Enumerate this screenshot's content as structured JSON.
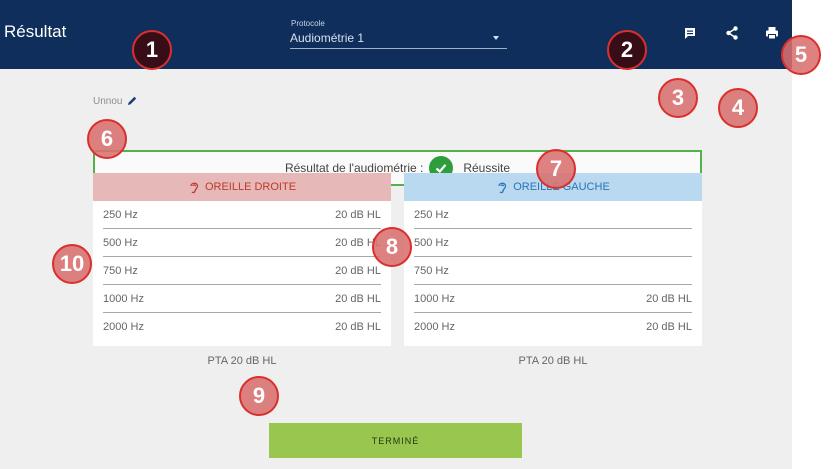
{
  "header": {
    "title": "Résultat",
    "protocol_label": "Protocole",
    "protocol_value": "Audiométrie 1"
  },
  "toolbar": {
    "icons": [
      "comment-icon",
      "share-icon",
      "print-icon"
    ]
  },
  "edit_label": "Unnou",
  "result": {
    "label": "Résultat de l'audiométrie :",
    "status": "Réussite"
  },
  "ears": {
    "right": {
      "title": "OREILLE DROITE",
      "rows": [
        {
          "hz": "250 Hz",
          "value": "20 dB HL"
        },
        {
          "hz": "500 Hz",
          "value": "20 dB HL"
        },
        {
          "hz": "750 Hz",
          "value": "20 dB HL"
        },
        {
          "hz": "1000 Hz",
          "value": "20 dB HL"
        },
        {
          "hz": "2000 Hz",
          "value": "20 dB HL"
        }
      ],
      "pta": "PTA 20 dB HL"
    },
    "left": {
      "title": "OREILLE GAUCHE",
      "rows": [
        {
          "hz": "250 Hz",
          "value": ""
        },
        {
          "hz": "500 Hz",
          "value": ""
        },
        {
          "hz": "750 Hz",
          "value": ""
        },
        {
          "hz": "1000 Hz",
          "value": "20 dB HL"
        },
        {
          "hz": "2000 Hz",
          "value": "20 dB HL"
        }
      ],
      "pta": "PTA 20 dB HL"
    }
  },
  "done_label": "TERMINÉ",
  "annotations": [
    "1",
    "2",
    "3",
    "4",
    "5",
    "6",
    "7",
    "8",
    "9",
    "10"
  ],
  "colors": {
    "header_bg": "#0f2e5c",
    "success_green": "#55b24a",
    "right_ear_header": "#e6b8b8",
    "right_ear_text": "#c0392b",
    "left_ear_header": "#b8d9f0",
    "left_ear_text": "#2a74b8",
    "done_button": "#98c64e",
    "badge_border": "#d9302e"
  }
}
